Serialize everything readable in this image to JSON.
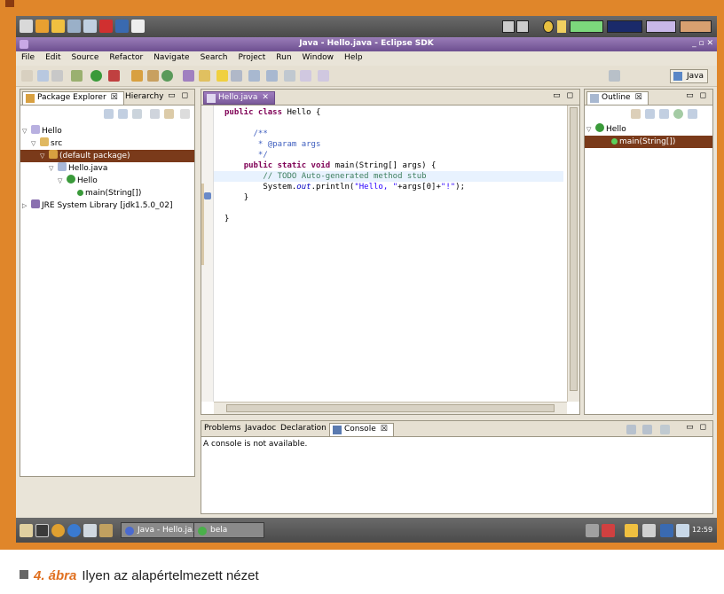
{
  "window": {
    "title": "Java - Hello.java - Eclipse SDK",
    "controls": "_ ▫ ✕"
  },
  "menu": [
    "File",
    "Edit",
    "Source",
    "Refactor",
    "Navigate",
    "Search",
    "Project",
    "Run",
    "Window",
    "Help"
  ],
  "perspective": {
    "label": "Java"
  },
  "left_panel": {
    "tabs": [
      {
        "label": "Package Explorer",
        "close": "☒"
      },
      {
        "label": "Hierarchy"
      }
    ],
    "tree": [
      {
        "label": "Hello",
        "twist": "▽"
      },
      {
        "label": "src",
        "twist": "▽"
      },
      {
        "label": "(default package)",
        "twist": "▽"
      },
      {
        "label": "Hello.java",
        "twist": "▽"
      },
      {
        "label": "Hello",
        "twist": "▽"
      },
      {
        "label": "main(String[])",
        "twist": ""
      },
      {
        "label": "JRE System Library [jdk1.5.0_02]",
        "twist": "▷"
      }
    ]
  },
  "editor": {
    "tab": {
      "label": "Hello.java",
      "close": "✕"
    },
    "lines": {
      "l1_kw": "public class",
      "l1_rest": " Hello {",
      "l2": "/**",
      "l3": " * @param args",
      "l4": " */",
      "l5_kw": "public static void",
      "l5_rest": " main(String[] args) {",
      "l6": "// TODO Auto-generated method stub",
      "l7_a": "System.",
      "l7_b": "out",
      "l7_c": ".println(",
      "l7_str1": "\"Hello, \"",
      "l7_d": "+args[0]+",
      "l7_str2": "\"!\"",
      "l7_e": ");",
      "l8": "}",
      "l9": "}"
    }
  },
  "outline": {
    "tab": {
      "label": "Outline",
      "close": "☒"
    },
    "tree": [
      {
        "label": "Hello",
        "twist": "▽"
      },
      {
        "label": "main(String[])"
      }
    ]
  },
  "bottom_tabs": [
    {
      "label": "Problems"
    },
    {
      "label": "Javadoc"
    },
    {
      "label": "Declaration"
    },
    {
      "label": "Console",
      "close": "☒"
    }
  ],
  "console": {
    "message": "A console is not available."
  },
  "taskbar": {
    "tasks": [
      {
        "label": "Java - Hello.ja..."
      },
      {
        "label": "bela"
      }
    ],
    "clock": "12:59"
  },
  "caption": {
    "figure": "4. ábra",
    "text": "Ilyen az alapértelmezett nézet"
  },
  "colors": {
    "frame": "#e0862a",
    "selection": "#7a3a1a",
    "titlebar": "#7a5a9a"
  }
}
